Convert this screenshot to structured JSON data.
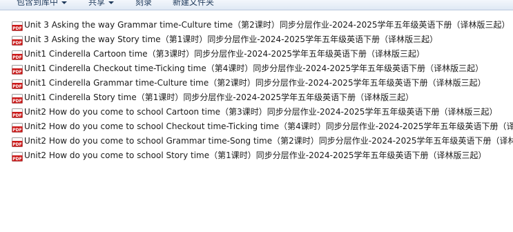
{
  "toolbar": {
    "items": [
      {
        "label": "包含到库中",
        "dropdown": true
      },
      {
        "label": "共享",
        "dropdown": true
      },
      {
        "label": "刻录",
        "dropdown": false
      },
      {
        "label": "新建文件夹",
        "dropdown": false
      }
    ]
  },
  "files": [
    {
      "icon": "pdf-icon",
      "name": "Unit 3 Asking the way Grammar time-Culture time（第2课时）同步分层作业-2024-2025学年五年级英语下册（译林版三起）"
    },
    {
      "icon": "pdf-icon",
      "name": "Unit 3 Asking the way Story time（第1课时）同步分层作业-2024-2025学年五年级英语下册（译林版三起）"
    },
    {
      "icon": "pdf-icon",
      "name": "Unit1 Cinderella Cartoon time（第3课时）同步分层作业-2024-2025学年五年级英语下册（译林版三起）"
    },
    {
      "icon": "pdf-icon",
      "name": "Unit1 Cinderella Checkout time-Ticking time（第4课时）同步分层作业-2024-2025学年五年级英语下册（译林版三起）"
    },
    {
      "icon": "pdf-icon",
      "name": "Unit1 Cinderella Grammar time-Culture time（第2课时）同步分层作业-2024-2025学年五年级英语下册（译林版三起）"
    },
    {
      "icon": "pdf-icon",
      "name": "Unit1 Cinderella Story time（第1课时）同步分层作业-2024-2025学年五年级英语下册（译林版三起）"
    },
    {
      "icon": "pdf-icon",
      "name": "Unit2 How do you come to school Cartoon time（第3课时）同步分层作业-2024-2025学年五年级英语下册（译林版三起）"
    },
    {
      "icon": "pdf-icon",
      "name": "Unit2 How do you come to school Checkout time-Ticking time（第4课时）同步分层作业-2024-2025学年五年级英语下册（译林"
    },
    {
      "icon": "pdf-icon",
      "name": "Unit2 How do you come to school Grammar time-Song time（第2课时）同步分层作业-2024-2025学年五年级英语下册（译林版"
    },
    {
      "icon": "pdf-icon",
      "name": "Unit2 How do you come to school Story time（第1课时）同步分层作业-2024-2025学年五年级英语下册（译林版三起）"
    }
  ],
  "colors": {
    "pdf_badge": "#cc1a1a",
    "toolbar_text": "#1e395b"
  }
}
